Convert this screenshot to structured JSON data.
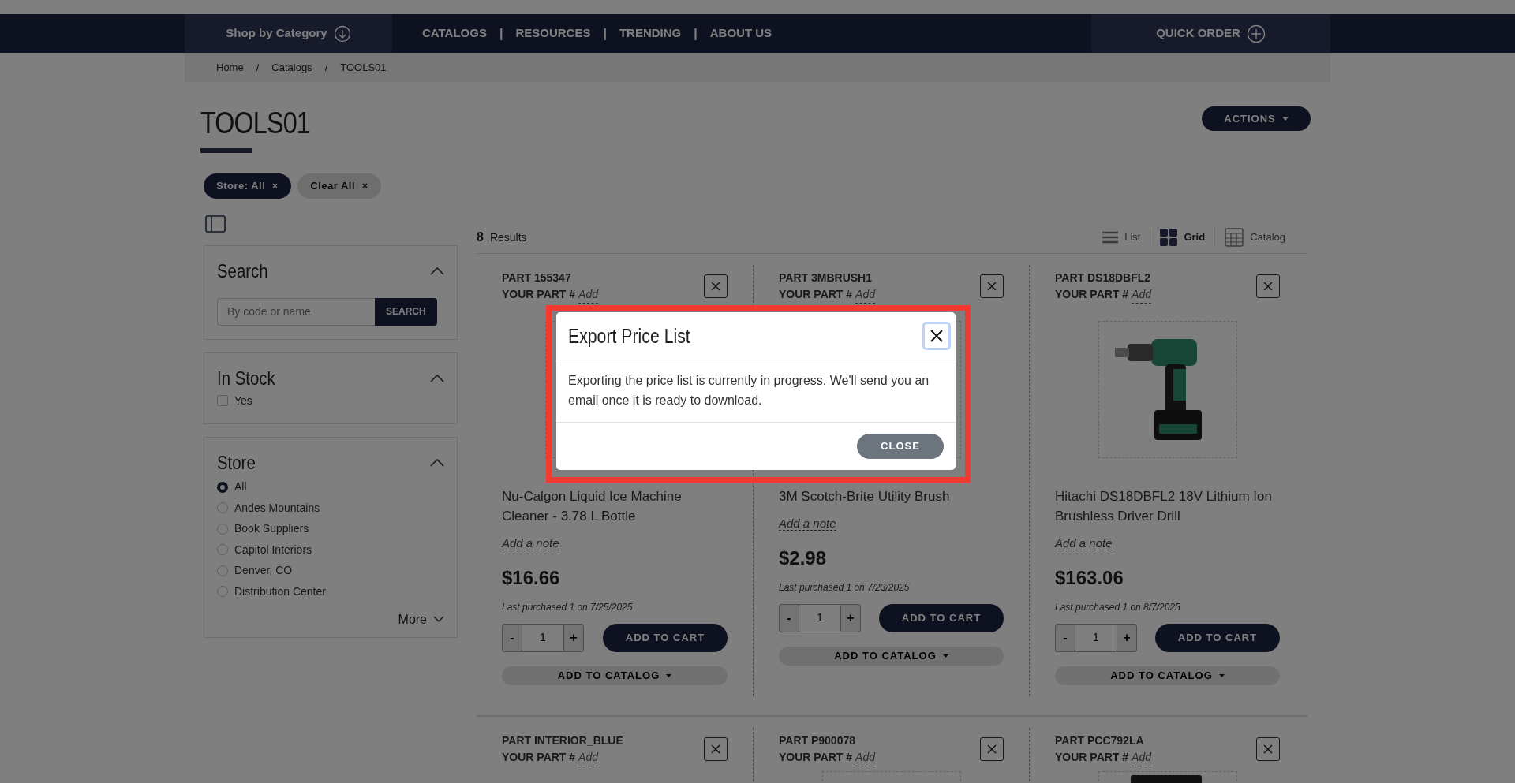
{
  "nav": {
    "category": "Shop by Category",
    "links": [
      "CATALOGS",
      "RESOURCES",
      "TRENDING",
      "ABOUT US"
    ],
    "separator": "|",
    "quick_order": "QUICK ORDER"
  },
  "breadcrumb": [
    "Home",
    "Catalogs",
    "TOOLS01"
  ],
  "breadcrumb_separator": "/",
  "page_title": "TOOLS01",
  "actions_button": "ACTIONS",
  "filter_chips": [
    {
      "label": "Store: All",
      "kind": "active"
    },
    {
      "label": "Clear All",
      "kind": "clear"
    }
  ],
  "sidebar": {
    "search": {
      "title": "Search",
      "expanded": true,
      "placeholder": "By code or name",
      "button": "SEARCH"
    },
    "in_stock": {
      "title": "In Stock",
      "expanded": true,
      "options": [
        {
          "label": "Yes",
          "checked": false
        }
      ]
    },
    "store": {
      "title": "Store",
      "expanded": true,
      "options": [
        {
          "label": "All",
          "selected": true
        },
        {
          "label": "Andes Mountains",
          "selected": false
        },
        {
          "label": "Book Suppliers",
          "selected": false
        },
        {
          "label": "Capitol Interiors",
          "selected": false
        },
        {
          "label": "Denver, CO",
          "selected": false
        },
        {
          "label": "Distribution Center",
          "selected": false
        }
      ],
      "more": "More"
    }
  },
  "results": {
    "count": "8",
    "label": "Results"
  },
  "views": [
    {
      "label": "List",
      "kind": "list",
      "selected": false
    },
    {
      "label": "Grid",
      "kind": "grid",
      "selected": true
    },
    {
      "label": "Catalog",
      "kind": "catalog",
      "selected": false
    }
  ],
  "products": [
    {
      "part": "PART 155347",
      "your_part": "YOUR PART #",
      "add": "Add",
      "name": "Nu-Calgon Liquid Ice Machine Cleaner - 3.78 L Bottle",
      "note": "Add a note",
      "price": "$16.66",
      "last_purchased": "Last purchased 1 on 7/25/2025",
      "minus": "-",
      "quantity": "1",
      "plus": "+",
      "add_to_cart": "ADD TO CART",
      "add_to_catalog": "ADD TO CATALOG"
    },
    {
      "part": "PART 3MBRUSH1",
      "your_part": "YOUR PART #",
      "add": "Add",
      "name": "3M Scotch-Brite Utility Brush",
      "note": "Add a note",
      "price": "$2.98",
      "last_purchased": "Last purchased 1 on 7/23/2025",
      "minus": "-",
      "quantity": "1",
      "plus": "+",
      "add_to_cart": "ADD TO CART",
      "add_to_catalog": "ADD TO CATALOG"
    },
    {
      "part": "PART DS18DBFL2",
      "your_part": "YOUR PART #",
      "add": "Add",
      "name": "Hitachi DS18DBFL2 18V Lithium Ion Brushless Driver Drill",
      "note": "Add a note",
      "price": "$163.06",
      "last_purchased": "Last purchased 1 on 8/7/2025",
      "minus": "-",
      "quantity": "1",
      "plus": "+",
      "add_to_cart": "ADD TO CART",
      "add_to_catalog": "ADD TO CATALOG"
    },
    {
      "part": "PART INTERIOR_BLUE",
      "your_part": "YOUR PART #",
      "add": "Add"
    },
    {
      "part": "PART P900078",
      "your_part": "YOUR PART #",
      "add": "Add"
    },
    {
      "part": "PART PCC792LA",
      "your_part": "YOUR PART #",
      "add": "Add"
    }
  ],
  "modal": {
    "title": "Export Price List",
    "body": "Exporting the price list is currently in progress. We'll send you an email once it is ready to download.",
    "close_button": "CLOSE"
  }
}
